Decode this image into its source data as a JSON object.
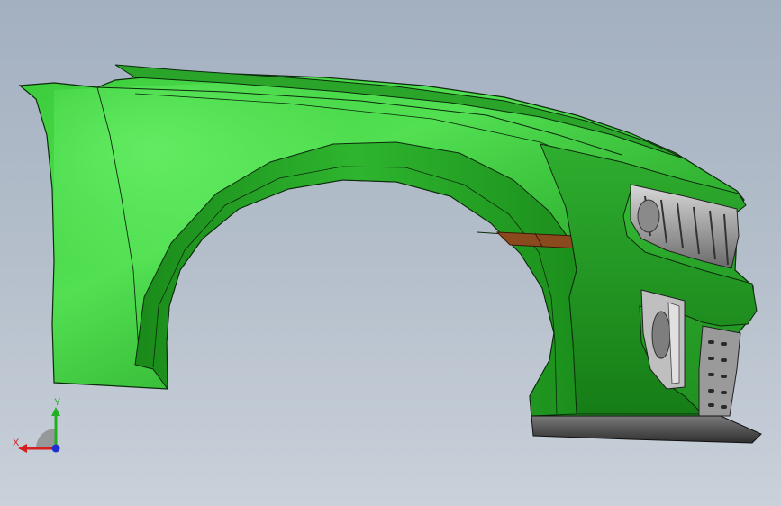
{
  "viewport": {
    "background_top": "#a3b0c0",
    "background_bottom": "#c9d1da"
  },
  "model": {
    "body_color": "#2fb12f",
    "highlight_color": "#55e055",
    "shadow_color": "#137413",
    "edge_color": "#0c2a0c",
    "marker_light_color": "#8b4a1e",
    "trim_color": "#4a4a4a"
  },
  "triad": {
    "x_label": "X",
    "y_label": "Y",
    "x_color": "#d42020",
    "y_color": "#22b022",
    "z_color": "#2030d0",
    "icon": "view-orientation-triad-icon"
  }
}
